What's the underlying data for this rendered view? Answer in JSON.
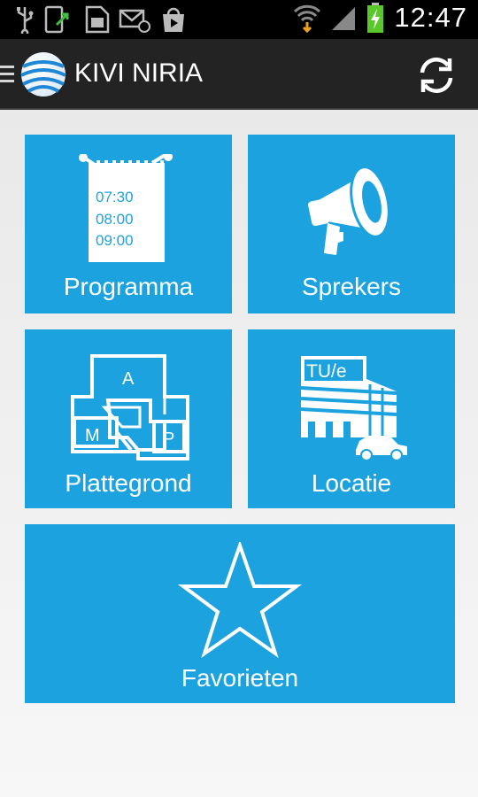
{
  "status_bar": {
    "time": "12:47",
    "icons": [
      "usb-icon",
      "phone-upload-icon",
      "sim-icon",
      "mail-icon",
      "play-store-icon",
      "wifi-icon",
      "signal-icon",
      "battery-charging-icon"
    ]
  },
  "app": {
    "title": "KIVI NIRIA",
    "logo": "globe-icon",
    "refresh_icon": "refresh-icon"
  },
  "tiles": [
    {
      "label": "Programma",
      "icon": "schedule-notepad-icon",
      "times": [
        "07:30",
        "08:00",
        "09:00"
      ]
    },
    {
      "label": "Sprekers",
      "icon": "megaphone-icon"
    },
    {
      "label": "Plattegrond",
      "icon": "floor-plan-icon",
      "map_letters": [
        "A",
        "M",
        "P"
      ]
    },
    {
      "label": "Locatie",
      "icon": "building-car-icon",
      "building_sign": "TU/e"
    },
    {
      "label": "Favorieten",
      "icon": "star-icon"
    }
  ],
  "colors": {
    "tile": "#1ca3df",
    "action_bar": "#232323",
    "status_bar": "#000000",
    "background": "#efefef"
  }
}
